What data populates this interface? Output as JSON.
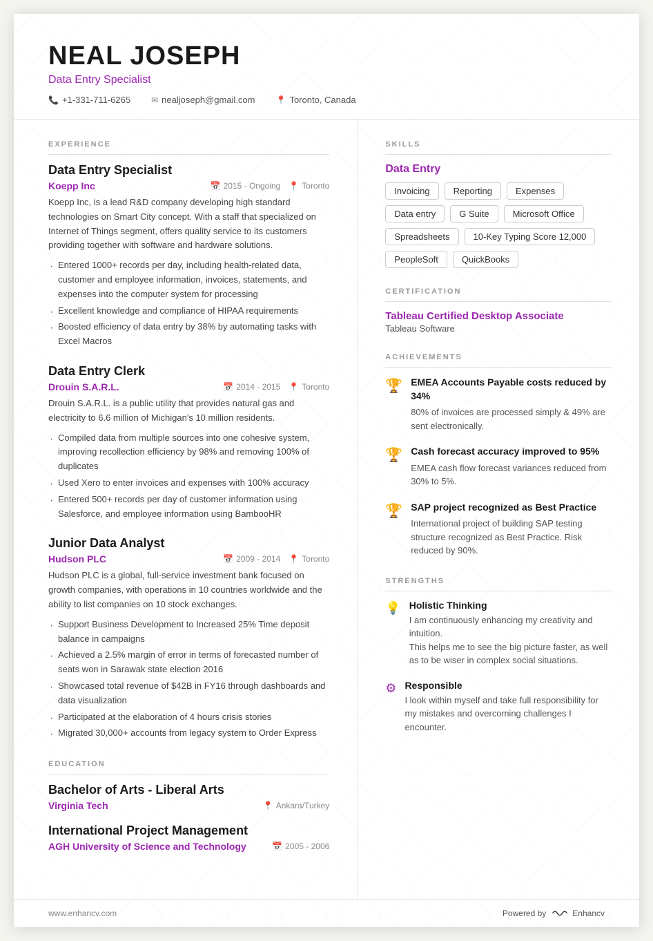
{
  "header": {
    "name": "NEAL JOSEPH",
    "title": "Data Entry Specialist",
    "contact": {
      "phone": "+1-331-711-6265",
      "email": "nealjoseph@gmail.com",
      "location": "Toronto, Canada"
    }
  },
  "sections": {
    "experience_label": "EXPERIENCE",
    "skills_label": "SKILLS",
    "certification_label": "CERTIFICATION",
    "achievements_label": "ACHIEVEMENTS",
    "education_label": "EDUCATION",
    "strengths_label": "STRENGTHS"
  },
  "experience": [
    {
      "title": "Data Entry Specialist",
      "company": "Koepp Inc",
      "period": "2015 - Ongoing",
      "location": "Toronto",
      "description": "Koepp Inc, is a lead R&D company developing high standard technologies on Smart City concept. With a staff that specialized on Internet of Things segment, offers quality service to its customers providing together with software and hardware solutions.",
      "bullets": [
        "Entered 1000+ records per day, including health-related data, customer and employee information, invoices, statements, and expenses into the computer system for processing",
        "Excellent knowledge and compliance of HIPAA requirements",
        "Boosted efficiency of data entry by 38% by automating tasks with Excel Macros"
      ]
    },
    {
      "title": "Data Entry Clerk",
      "company": "Drouin S.A.R.L.",
      "period": "2014 - 2015",
      "location": "Toronto",
      "description": "Drouin S.A.R.L. is a public utility that provides natural gas and electricity to 6.6 million of Michigan's 10 million residents.",
      "bullets": [
        "Compiled data from multiple sources into one cohesive system, improving recollection efficiency by 98% and removing 100% of duplicates",
        "Used Xero to enter invoices and expenses with 100% accuracy",
        "Entered 500+ records per day of customer information using Salesforce, and employee information using BambooHR"
      ]
    },
    {
      "title": "Junior Data Analyst",
      "company": "Hudson PLC",
      "period": "2009 - 2014",
      "location": "Toronto",
      "description": "Hudson PLC is a global, full-service investment bank focused on growth companies, with operations in 10 countries worldwide and the ability to list companies on 10 stock exchanges.",
      "bullets": [
        "Support Business Development to Increased 25% Time deposit balance in campaigns",
        "Achieved a 2.5% margin of error in terms of forecasted number of seats won in Sarawak state election 2016",
        "Showcased total revenue of $42B in FY16 through dashboards and data visualization",
        "Participated at the elaboration of 4 hours crisis stories",
        "Migrated 30,000+ accounts from legacy system to Order Express"
      ]
    }
  ],
  "education": [
    {
      "degree": "Bachelor of Arts - Liberal Arts",
      "school": "Virginia Tech",
      "location": "Ankara/Turkey",
      "period": ""
    },
    {
      "degree": "International Project Management",
      "school": "AGH University of Science and Technology",
      "location": "",
      "period": "2005 - 2006"
    }
  ],
  "skills": {
    "category": "Data Entry",
    "items": [
      "Invoicing",
      "Reporting",
      "Expenses",
      "Data entry",
      "G Suite",
      "Microsoft Office",
      "Spreadsheets",
      "10-Key Typing Score 12,000",
      "PeopleSoft",
      "QuickBooks"
    ]
  },
  "certification": {
    "title": "Tableau Certified Desktop Associate",
    "org": "Tableau Software"
  },
  "achievements": [
    {
      "title": "EMEA Accounts Payable costs reduced by 34%",
      "desc": "80% of invoices are processed simply & 49% are sent electronically."
    },
    {
      "title": "Cash forecast accuracy improved to 95%",
      "desc": "EMEA cash flow forecast variances reduced from 30% to 5%."
    },
    {
      "title": "SAP project recognized as Best Practice",
      "desc": "International project of building SAP testing structure recognized as Best Practice. Risk reduced by 90%."
    }
  ],
  "strengths": [
    {
      "title": "Holistic Thinking",
      "desc": "I am continuously enhancing my creativity and intuition.\nThis helps me to see the big picture faster, as well as to be wiser in complex social situations."
    },
    {
      "title": "Responsible",
      "desc": "I look within myself and take full responsibility for my mistakes and overcoming challenges I encounter."
    }
  ],
  "footer": {
    "website": "www.enhancv.com",
    "powered_by": "Powered by",
    "brand": "Enhancv"
  }
}
